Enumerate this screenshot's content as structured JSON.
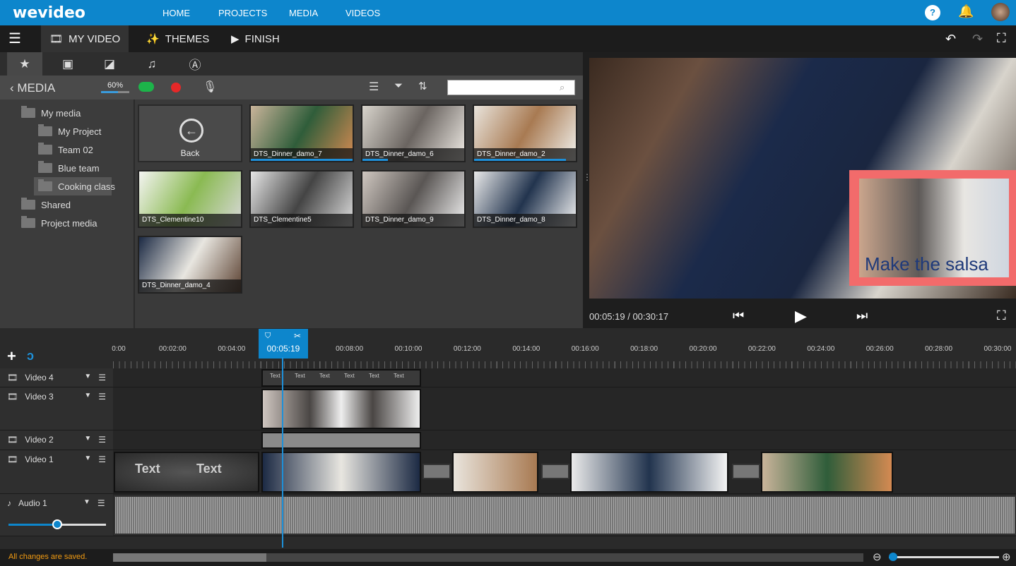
{
  "app": {
    "logo": "wevideo"
  },
  "topnav": {
    "items": [
      "HOME",
      "PROJECTS",
      "MEDIA",
      "VIDEOS"
    ]
  },
  "tabs": {
    "my_video": "MY VIDEO",
    "themes": "THEMES",
    "finish": "FINISH"
  },
  "media": {
    "back_label": "MEDIA",
    "upload_progress": "60%",
    "upload_fraction": 0.6,
    "search_placeholder": "",
    "folders": [
      {
        "name": "My media",
        "level": 0
      },
      {
        "name": "My Project",
        "level": 1
      },
      {
        "name": "Team 02",
        "level": 1
      },
      {
        "name": "Blue team",
        "level": 1
      },
      {
        "name": "Cooking class",
        "level": 1,
        "selected": true
      },
      {
        "name": "Shared",
        "level": 0
      },
      {
        "name": "Project media",
        "level": 0
      }
    ],
    "back_tile": "Back",
    "items": [
      {
        "name": "DTS_Dinner_damo_7",
        "progress": 1
      },
      {
        "name": "DTS_Dinner_damo_6",
        "progress": 0.25
      },
      {
        "name": "DTS_Dinner_damo_2",
        "progress": 0.9
      },
      {
        "name": "DTS_Clementine10"
      },
      {
        "name": "DTS_Clementine5"
      },
      {
        "name": "DTS_Dinner_damo_9"
      },
      {
        "name": "DTS_Dinner_damo_8"
      },
      {
        "name": "DTS_Dinner_damo_4"
      }
    ]
  },
  "preview": {
    "overlay_text": "Make the salsa",
    "time": "00:05:19 / 00:30:17"
  },
  "timeline": {
    "playhead": "00:05:19",
    "ticks": [
      "0:00",
      "00:02:00",
      "00:04:00",
      "00:06:00",
      "00:08:00",
      "00:10:00",
      "00:12:00",
      "00:14:00",
      "00:16:00",
      "00:18:00",
      "00:20:00",
      "00:22:00",
      "00:24:00",
      "00:26:00",
      "00:28:00",
      "00:30:00"
    ],
    "tracks": [
      "Video 4",
      "Video 3",
      "Video 2",
      "Video 1",
      "Audio 1"
    ],
    "text_clip_label": "Text",
    "audio_volume": 0.5
  },
  "status": {
    "saved": "All changes are saved."
  },
  "colors": {
    "brand": "#0d86cc",
    "status": "#f39c12",
    "overlay": "#f26b6b"
  }
}
